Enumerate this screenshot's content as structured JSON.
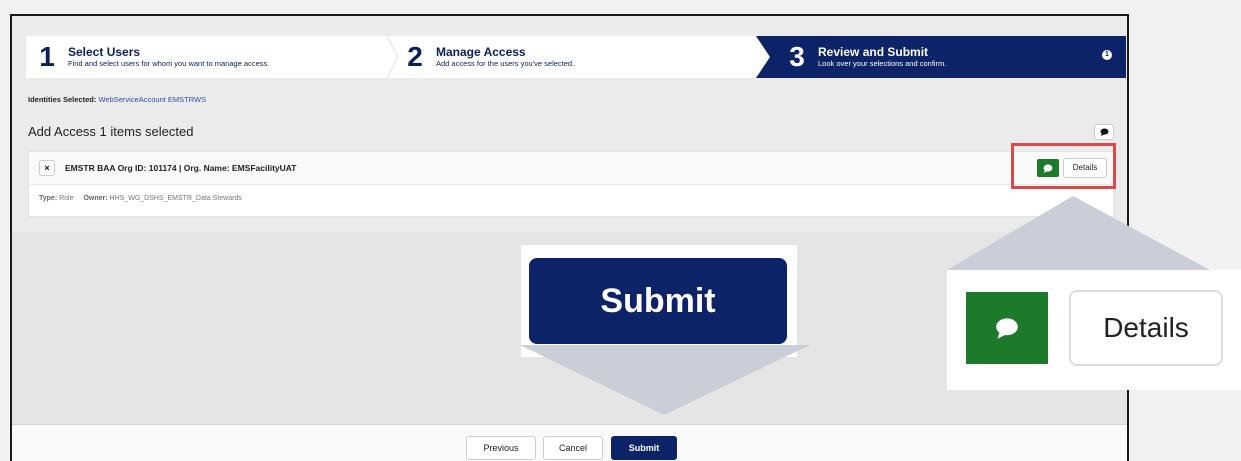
{
  "steps": [
    {
      "num": "1",
      "title": "Select Users",
      "sub": "Find and select users for whom you want to manage access."
    },
    {
      "num": "2",
      "title": "Manage Access",
      "sub": "Add access for the users you've selected."
    },
    {
      "num": "3",
      "title": "Review and Submit",
      "sub": "Look over your selections and confirm."
    }
  ],
  "badge": "1",
  "identities": {
    "label": "Identities Selected:",
    "value": "WebServiceAccount EMSTRWS"
  },
  "add_heading": "Add Access 1 items selected",
  "item": {
    "remove": "×",
    "title": "EMSTR BAA Org ID: 101174 | Org. Name: EMSFacilityUAT",
    "type_label": "Type:",
    "type_value": "Role",
    "owner_label": "Owner:",
    "owner_value": "HHS_WG_DSHS_EMSTR_Data Stewards",
    "details_label": "Details"
  },
  "callouts": {
    "details_label": "Details",
    "submit_label": "Submit"
  },
  "footer": {
    "previous": "Previous",
    "cancel": "Cancel",
    "submit": "Submit"
  },
  "colors": {
    "navy": "#0d2367",
    "green": "#1c7a2a",
    "highlight": "#e04848"
  }
}
